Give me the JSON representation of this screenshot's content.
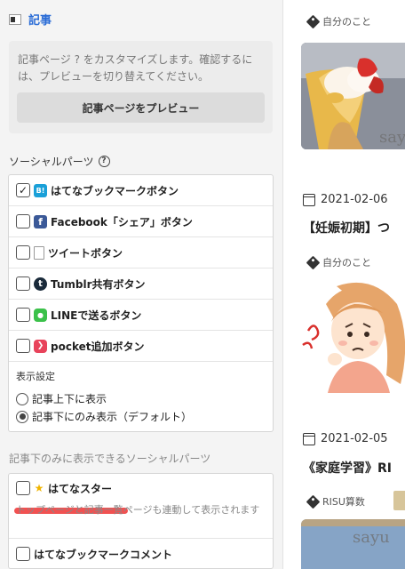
{
  "left_panel": {
    "section_title": "記事",
    "intro_text": "記事ページ ? をカスタマイズします。確認するには、プレビューを切り替えてください。",
    "preview_button": "記事ページをプレビュー",
    "social_parts_title": "ソーシャルパーツ",
    "social_options": [
      {
        "label": "はてなブックマークボタン",
        "icon": "hatena-bookmark-icon",
        "checked": true
      },
      {
        "label": "Facebook「シェア」ボタン",
        "icon": "facebook-icon",
        "checked": false
      },
      {
        "label": "ツイートボタン",
        "icon": "tweet-icon",
        "checked": false
      },
      {
        "label": "Tumblr共有ボタン",
        "icon": "tumblr-icon",
        "checked": false
      },
      {
        "label": "LINEで送るボタン",
        "icon": "line-icon",
        "checked": false
      },
      {
        "label": "pocket追加ボタン",
        "icon": "pocket-icon",
        "checked": false
      }
    ],
    "display_settings_label": "表示設定",
    "display_options": [
      {
        "label": "記事上下に表示",
        "selected": false
      },
      {
        "label": "記事下にのみ表示（デフォルト）",
        "selected": true
      }
    ],
    "below_only_title": "記事下のみに表示できるソーシャルパーツ",
    "below_options": [
      {
        "label": "はてなスター",
        "icon": "star-icon",
        "checked": false,
        "note": "トップページと記事一覧ページも連動して表示されます"
      },
      {
        "label": "はてなブックマークコメント",
        "checked": false
      }
    ]
  },
  "right_panel": {
    "posts": [
      {
        "tag": "自分のこと"
      },
      {
        "date": "2021-02-06",
        "title": "【妊娠初期】つ",
        "tag": "自分のこと"
      },
      {
        "date": "2021-02-05",
        "title": "《家庭学習》RI",
        "tag": "RISU算数"
      }
    ],
    "watermark": "sayu",
    "colors": {
      "accent": "#2a6cd6",
      "crepe": "#f2c14e",
      "strawberry": "#d9302c",
      "highlight": "#e33333"
    }
  }
}
